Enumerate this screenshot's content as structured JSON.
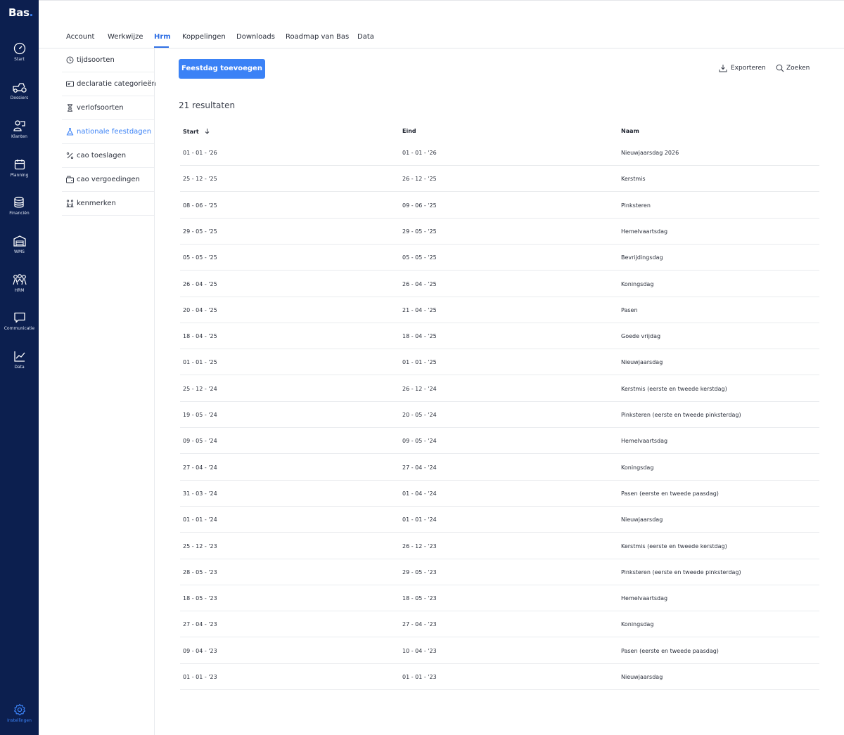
{
  "brand": {
    "logo_text": "Bas",
    "logo_dot": "."
  },
  "sidebar": {
    "items": [
      {
        "label": "Start",
        "icon": "dashboard-gauge-icon"
      },
      {
        "label": "Dossiers",
        "icon": "machine-icon"
      },
      {
        "label": "Klanten",
        "icon": "customers-icon"
      },
      {
        "label": "Planning",
        "icon": "calendar-icon"
      },
      {
        "label": "Financiën",
        "icon": "coins-stack-icon"
      },
      {
        "label": "WMS",
        "icon": "warehouse-icon"
      },
      {
        "label": "HRM",
        "icon": "people-icon"
      },
      {
        "label": "Communicatie",
        "icon": "chat-bubble-icon"
      },
      {
        "label": "Data",
        "icon": "line-chart-icon"
      }
    ],
    "settings": {
      "label": "Instellingen",
      "icon": "gear-icon"
    }
  },
  "tabs": [
    {
      "label": "Account"
    },
    {
      "label": "Werkwijze"
    },
    {
      "label": "Hrm",
      "active": true
    },
    {
      "label": "Koppelingen"
    },
    {
      "label": "Downloads"
    },
    {
      "label": "Roadmap van Bas"
    },
    {
      "label": "Data"
    }
  ],
  "submenu": [
    {
      "label": "tijdsoorten",
      "icon": "clock-icon"
    },
    {
      "label": "declaratie categorieën",
      "icon": "receipt-icon"
    },
    {
      "label": "verlofsoorten",
      "icon": "hourglass-icon"
    },
    {
      "label": "nationale feestdagen",
      "icon": "flask-icon",
      "active": true
    },
    {
      "label": "cao toeslagen",
      "icon": "percent-icon"
    },
    {
      "label": "cao vergoedingen",
      "icon": "wallet-icon"
    },
    {
      "label": "kenmerken",
      "icon": "traits-icon"
    }
  ],
  "toolbar": {
    "add_label": "Feestdag toevoegen",
    "export_label": "Exporteren",
    "search_label": "Zoeken"
  },
  "results_text": "21 resultaten",
  "table": {
    "columns": {
      "start": "Start",
      "end": "Eind",
      "name": "Naam"
    },
    "sort_icon": "arrow-down-icon",
    "rows": [
      {
        "start": "01 - 01 - '26",
        "end": "01 - 01 - '26",
        "name": "Nieuwjaarsdag 2026"
      },
      {
        "start": "25 - 12 - '25",
        "end": "26 - 12 - '25",
        "name": "Kerstmis"
      },
      {
        "start": "08 - 06 - '25",
        "end": "09 - 06 - '25",
        "name": "Pinksteren"
      },
      {
        "start": "29 - 05 - '25",
        "end": "29 - 05 - '25",
        "name": "Hemelvaartsdag"
      },
      {
        "start": "05 - 05 - '25",
        "end": "05 - 05 - '25",
        "name": "Bevrijdingsdag"
      },
      {
        "start": "26 - 04 - '25",
        "end": "26 - 04 - '25",
        "name": "Koningsdag"
      },
      {
        "start": "20 - 04 - '25",
        "end": "21 - 04 - '25",
        "name": "Pasen"
      },
      {
        "start": "18 - 04 - '25",
        "end": "18 - 04 - '25",
        "name": "Goede vrijdag"
      },
      {
        "start": "01 - 01 - '25",
        "end": "01 - 01 - '25",
        "name": "Nieuwjaarsdag"
      },
      {
        "start": "25 - 12 - '24",
        "end": "26 - 12 - '24",
        "name": "Kerstmis (eerste en tweede kerstdag)"
      },
      {
        "start": "19 - 05 - '24",
        "end": "20 - 05 - '24",
        "name": "Pinksteren (eerste en tweede pinksterdag)"
      },
      {
        "start": "09 - 05 - '24",
        "end": "09 - 05 - '24",
        "name": "Hemelvaartsdag"
      },
      {
        "start": "27 - 04 - '24",
        "end": "27 - 04 - '24",
        "name": "Koningsdag"
      },
      {
        "start": "31 - 03 - '24",
        "end": "01 - 04 - '24",
        "name": "Pasen (eerste en tweede paasdag)"
      },
      {
        "start": "01 - 01 - '24",
        "end": "01 - 01 - '24",
        "name": "Nieuwjaarsdag"
      },
      {
        "start": "25 - 12 - '23",
        "end": "26 - 12 - '23",
        "name": "Kerstmis (eerste en tweede kerstdag)"
      },
      {
        "start": "28 - 05 - '23",
        "end": "29 - 05 - '23",
        "name": "Pinksteren (eerste en tweede pinksterdag)"
      },
      {
        "start": "18 - 05 - '23",
        "end": "18 - 05 - '23",
        "name": "Hemelvaartsdag"
      },
      {
        "start": "27 - 04 - '23",
        "end": "27 - 04 - '23",
        "name": "Koningsdag"
      },
      {
        "start": "09 - 04 - '23",
        "end": "10 - 04 - '23",
        "name": "Pasen (eerste en tweede paasdag)"
      },
      {
        "start": "01 - 01 - '23",
        "end": "01 - 01 - '23",
        "name": "Nieuwjaarsdag"
      }
    ]
  },
  "colors": {
    "sidebar_bg": "#0c1f4f",
    "accent": "#3b82f6",
    "active_tab": "#2f6fe4"
  }
}
